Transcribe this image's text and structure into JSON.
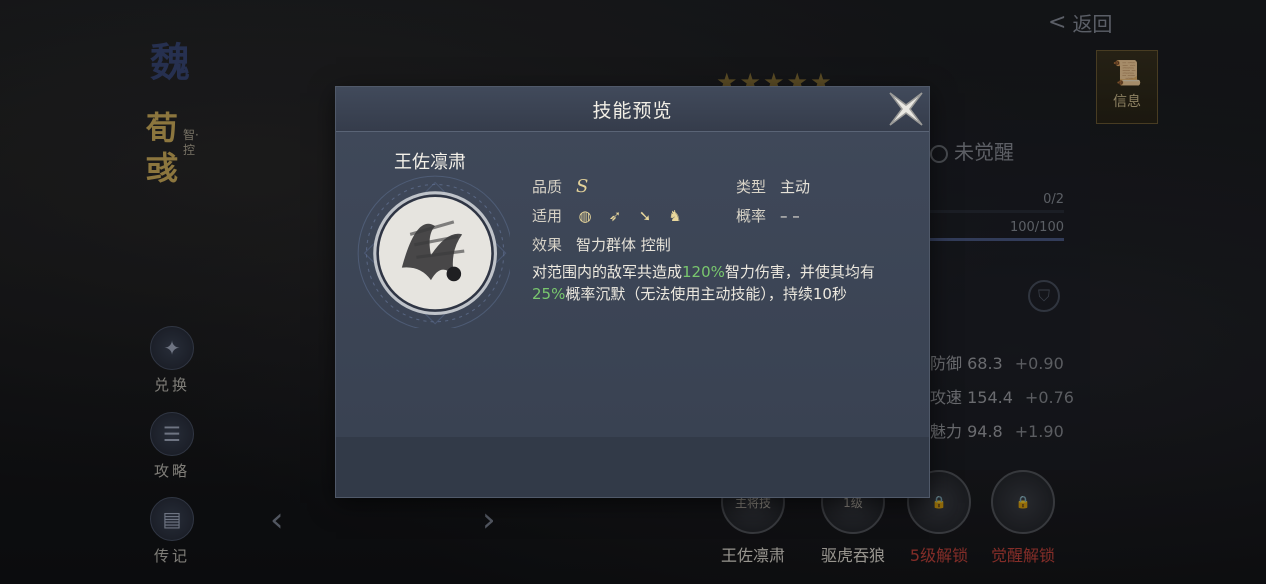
{
  "background": {
    "faction": "魏",
    "hero": {
      "name": "荀彧",
      "type": "智·控"
    },
    "back_label": "返回",
    "info_tab_label": "信息",
    "side_buttons": [
      {
        "label": "兑换",
        "icon": "exchange-icon"
      },
      {
        "label": "攻略",
        "icon": "scroll-icon"
      },
      {
        "label": "传记",
        "icon": "book-icon"
      }
    ],
    "awaken_status": "未觉醒",
    "progress": [
      {
        "label": "0/2",
        "value": 0.0
      },
      {
        "label": "100/100",
        "value": 1.0
      }
    ],
    "stats": [
      {
        "label": "防御 68.3",
        "inc": "+0.90"
      },
      {
        "label": "攻速 154.4",
        "inc": "+0.76"
      },
      {
        "label": "魅力 94.8",
        "inc": "+1.90"
      }
    ],
    "skill_slots": [
      {
        "label": "王佐凛肃",
        "badge": "主将技",
        "color": "#e8e4da"
      },
      {
        "label": "驱虎吞狼",
        "badge": "1级",
        "color": "#e8e4da"
      },
      {
        "label": "5级解锁",
        "badge": "",
        "color": "#c9463e"
      },
      {
        "label": "觉醒解锁",
        "badge": "",
        "color": "#c9463e"
      }
    ]
  },
  "modal": {
    "title": "技能预览",
    "skill_name": "王佐凛肃",
    "quality_label": "品质",
    "quality_value": "S",
    "apply_label": "适用",
    "apply_icons": [
      "shield-icon",
      "bow-icon",
      "spear-icon",
      "horse-icon"
    ],
    "effect_label": "效果",
    "effect_value": "智力群体 控制",
    "type_label": "类型",
    "type_value": "主动",
    "rate_label": "概率",
    "rate_value": "– –",
    "description": {
      "p1": "对范围内的敌军共造成",
      "h1": "120%",
      "p2": "智力伤害，并使其均有",
      "h2": "25%",
      "p3": "概率沉默（无法使用主动技能），持续10秒"
    },
    "highlight_color": "#79c76e"
  }
}
